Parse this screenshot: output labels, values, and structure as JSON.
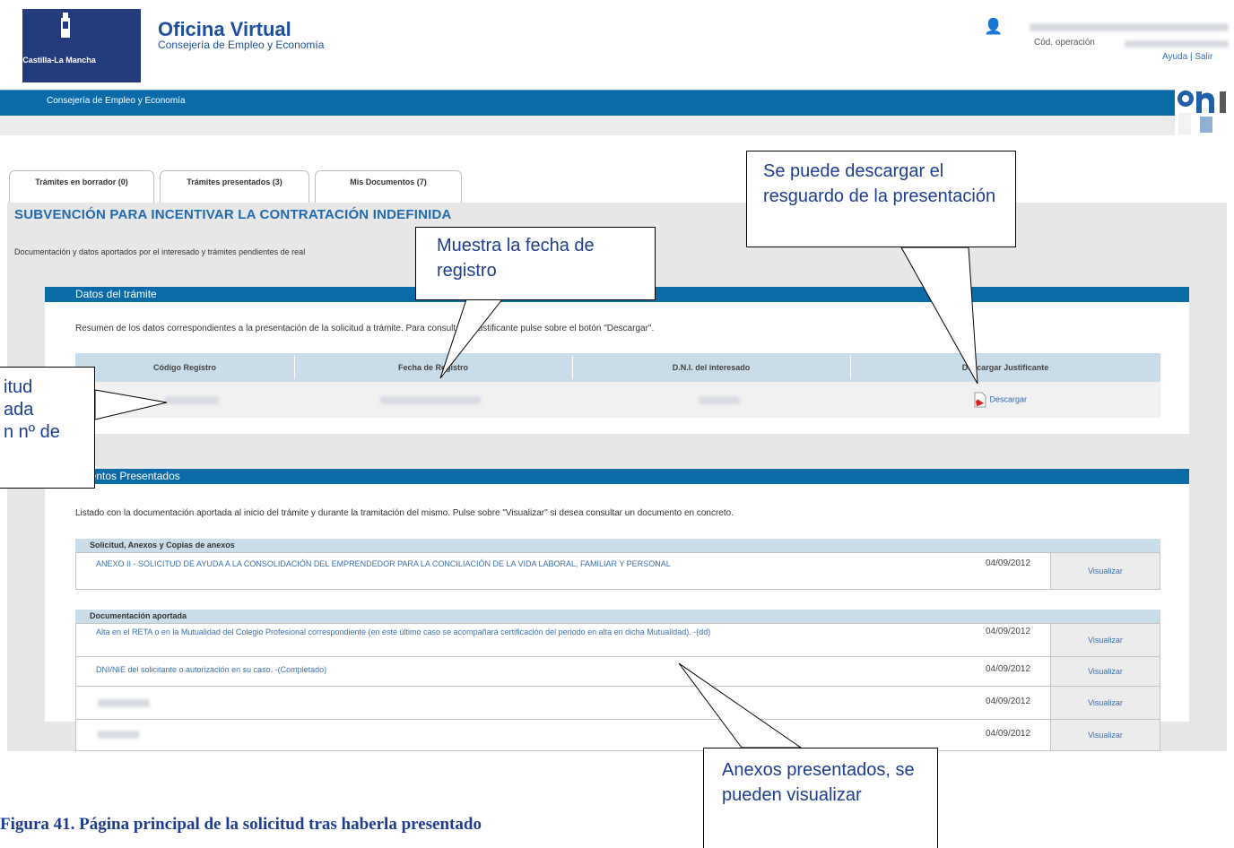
{
  "header": {
    "logo_text": "Castilla-La Mancha",
    "title": "Oficina Virtual",
    "subtitle": "Consejería de Empleo y Economía",
    "operation_label": "Cód. operación",
    "help_links": "Ayuda | Salir",
    "bar_text": "Consejería de Empleo y Economía"
  },
  "tabs": [
    {
      "label": "Trámites en borrador (0)"
    },
    {
      "label": "Trámites presentados (3)"
    },
    {
      "label": "Mis Documentos (7)"
    }
  ],
  "main": {
    "title": "SUBVENCIÓN PARA INCENTIVAR LA CONTRATACIÓN INDEFINIDA",
    "description": "Documentación y datos aportados por el interesado y trámites pendientes de real"
  },
  "datos": {
    "header": "Datos del trámite",
    "intro": "Resumen de los datos correspondientes a la presentación de la solicitud            a trámite. Para consultar el justificante pulse sobre el botón \"Descargar\".",
    "columns": [
      "Código Registro",
      "Fecha de Registro",
      "D.N.I. del interesado",
      "Descargar Justificante"
    ],
    "download_label": "Descargar"
  },
  "documentos": {
    "header": "umentos Presentados",
    "intro": "Listado con la documentación aportada al inicio del trámite y durante la tramitación del mismo. Pulse sobre \"Visualizar\" si desea consultar un documento en concreto.",
    "group1": "Solicitud, Anexos y Copias de anexos",
    "group2": "Documentación aportada",
    "rows": [
      {
        "text": "ANEXO II - SOLICITUD DE AYUDA A LA CONSOLIDACIÓN DEL EMPRENDEDOR PARA LA CONCILIACIÓN DE LA VIDA LABORAL, FAMILIAR Y PERSONAL",
        "date": "04/09/2012",
        "action": "Visualizar"
      },
      {
        "text": "Alta en el RETA o en la Mutualidad del Colegio Profesional correspondiente (en este último caso se acompañará certificación del periodo en alta en dicha Mutualidad). -(dd)",
        "date": "04/09/2012",
        "action": "Visualizar"
      },
      {
        "text": "DNI/NIE del solicitante o autorización en su caso. -(Completado)",
        "date": "04/09/2012",
        "action": "Visualizar"
      },
      {
        "text": "",
        "date": "04/09/2012",
        "action": "Visualizar"
      },
      {
        "text": "",
        "date": "04/09/2012",
        "action": "Visualizar"
      }
    ]
  },
  "callouts": {
    "fecha": "Muestra la fecha de registro",
    "descargar": "Se puede descargar el resguardo de la presentación",
    "anexos": "Anexos presentados, se pueden visualizar",
    "solicitud_l1": "itud",
    "solicitud_l2": "ada",
    "solicitud_l3": "n nº de"
  },
  "caption": "Figura 41. Página principal de la solicitud tras haberla presentado",
  "colors": {
    "brand_blue": "#0b6ba9",
    "header_navy": "#243c7e",
    "light_blue": "#c9dce9"
  },
  "icons": [
    "user-icon",
    "pdf-icon",
    "crest-icon",
    "on-logo"
  ]
}
